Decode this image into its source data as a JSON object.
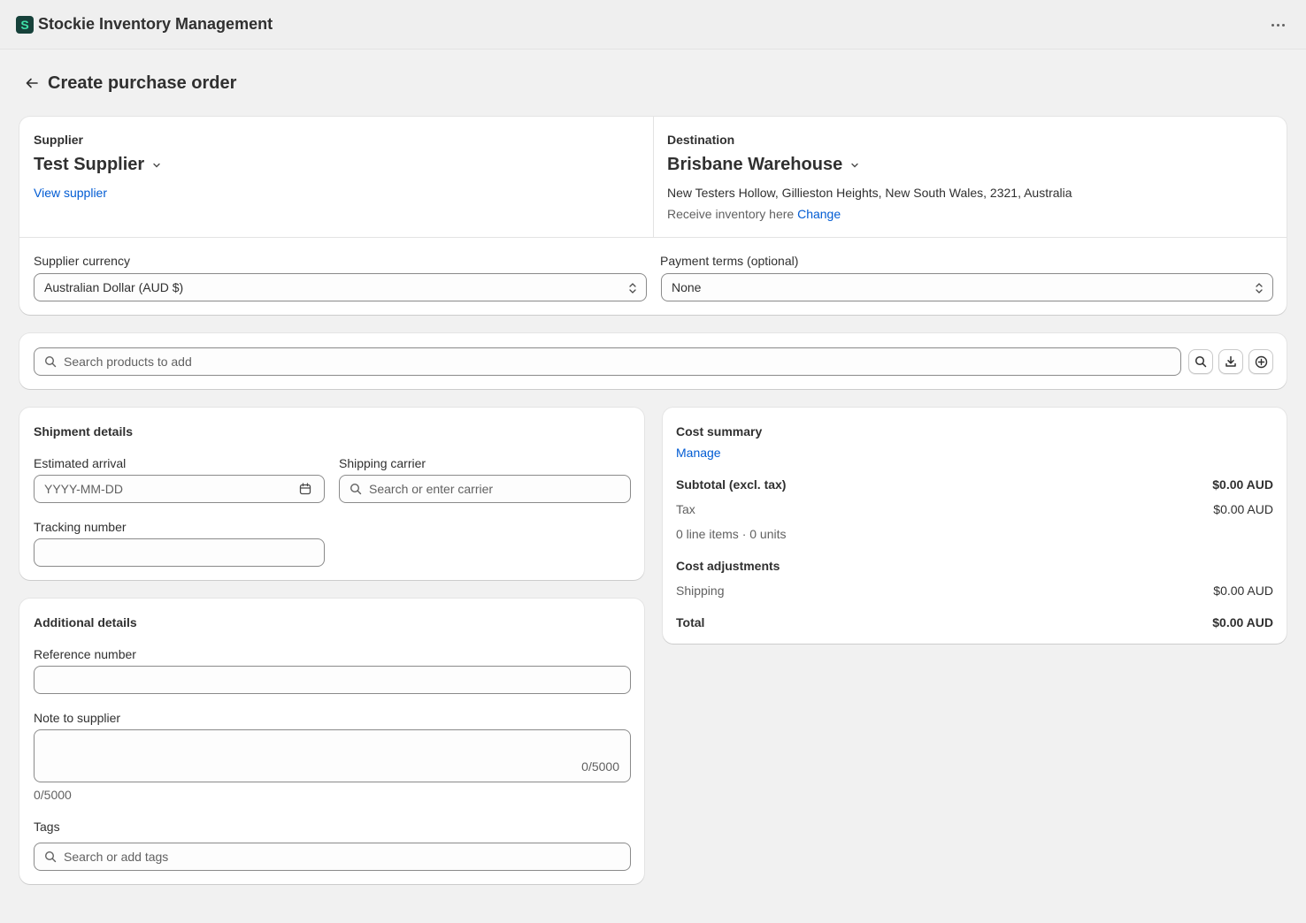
{
  "app": {
    "title": "Stockie Inventory Management",
    "logo_letter": "S"
  },
  "page": {
    "title": "Create purchase order"
  },
  "supplier": {
    "label": "Supplier",
    "name": "Test Supplier",
    "view_link": "View supplier"
  },
  "destination": {
    "label": "Destination",
    "name": "Brisbane Warehouse",
    "address": "New Testers Hollow, Gillieston Heights, New South Wales, 2321, Australia",
    "receive_text": "Receive inventory here",
    "change_link": "Change"
  },
  "currency": {
    "label": "Supplier currency",
    "value": "Australian Dollar (AUD $)"
  },
  "payment_terms": {
    "label": "Payment terms (optional)",
    "value": "None"
  },
  "product_search": {
    "placeholder": "Search products to add"
  },
  "shipment": {
    "title": "Shipment details",
    "arrival_label": "Estimated arrival",
    "arrival_placeholder": "YYYY-MM-DD",
    "carrier_label": "Shipping carrier",
    "carrier_placeholder": "Search or enter carrier",
    "tracking_label": "Tracking number",
    "tracking_value": ""
  },
  "additional": {
    "title": "Additional details",
    "reference_label": "Reference number",
    "reference_value": "",
    "note_label": "Note to supplier",
    "note_counter": "0/5000",
    "note_counter_below": "0/5000",
    "tags_label": "Tags",
    "tags_placeholder": "Search or add tags"
  },
  "cost_summary": {
    "title": "Cost summary",
    "manage_link": "Manage",
    "subtotal_label": "Subtotal (excl. tax)",
    "subtotal_value": "$0.00 AUD",
    "tax_label": "Tax",
    "tax_value": "$0.00 AUD",
    "items_text": "0 line items · 0 units",
    "adjustments_title": "Cost adjustments",
    "shipping_label": "Shipping",
    "shipping_value": "$0.00 AUD",
    "total_label": "Total",
    "total_value": "$0.00 AUD"
  },
  "colors": {
    "link": "#005bd3",
    "background": "#f1f1f1",
    "logo_bg": "#16413a",
    "logo_fg": "#3fe0a8"
  }
}
